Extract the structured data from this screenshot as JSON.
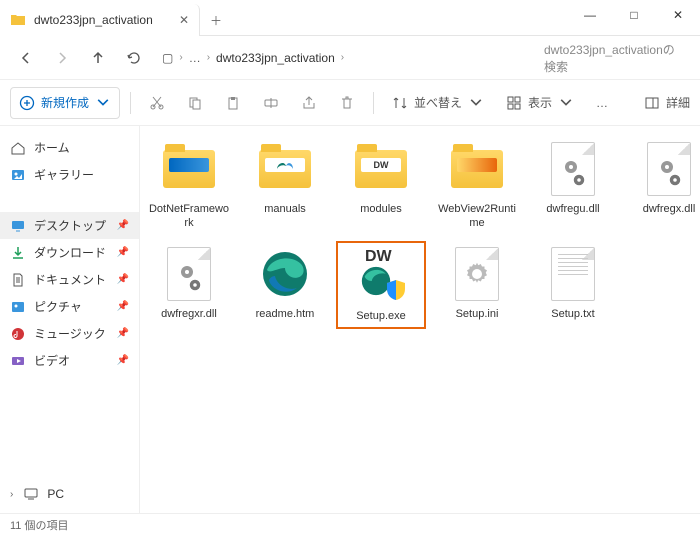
{
  "window": {
    "tab_title": "dwto233jpn_activation",
    "minimize_glyph": "—",
    "maximize_glyph": "□",
    "close_glyph": "✕",
    "tab_close_glyph": "✕",
    "newtab_glyph": "＋"
  },
  "nav": {
    "monitor_glyph": "▢",
    "chev_glyph": "›",
    "more_glyph": "…",
    "current": "dwto233jpn_activation",
    "search_placeholder": "dwto233jpn_activationの検索"
  },
  "toolbar": {
    "new_label": "新規作成",
    "sort_label": "並べ替え",
    "view_label": "表示",
    "more_glyph": "…",
    "details_label": "詳細"
  },
  "sidebar": {
    "home": "ホーム",
    "gallery": "ギャラリー",
    "desktop": "デスクトップ",
    "downloads": "ダウンロード",
    "documents": "ドキュメント",
    "pictures": "ピクチャ",
    "music": "ミュージック",
    "videos": "ビデオ",
    "pc": "PC"
  },
  "items": {
    "dotnet": "DotNetFramework",
    "manuals": "manuals",
    "modules": "modules",
    "webview": "WebView2Runtime",
    "dwfregu": "dwfregu.dll",
    "dwfregx": "dwfregx.dll",
    "dwfregxr": "dwfregxr.dll",
    "readme": "readme.htm",
    "setupexe": "Setup.exe",
    "setupini": "Setup.ini",
    "setuptxt": "Setup.txt",
    "dw_badge": "DW"
  },
  "status": {
    "count": "11 個の項目"
  }
}
